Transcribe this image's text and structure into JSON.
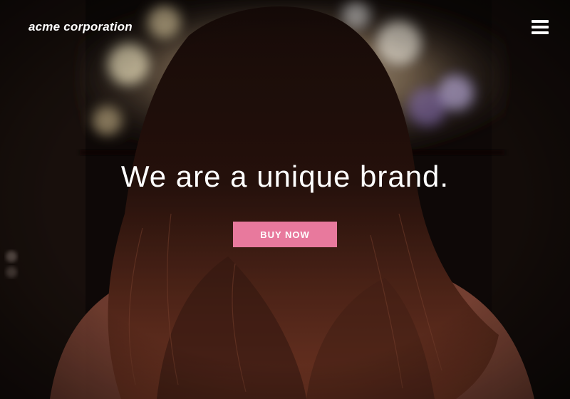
{
  "header": {
    "logo_text": "acme corporation",
    "menu_icon": "hamburger-menu-icon"
  },
  "hero": {
    "headline": "We are a unique brand.",
    "cta_label": "BUY NOW",
    "cta_color": "#e8799d",
    "background_image": "woman with long hair viewed from behind facing a glowing screen in a dark room"
  }
}
